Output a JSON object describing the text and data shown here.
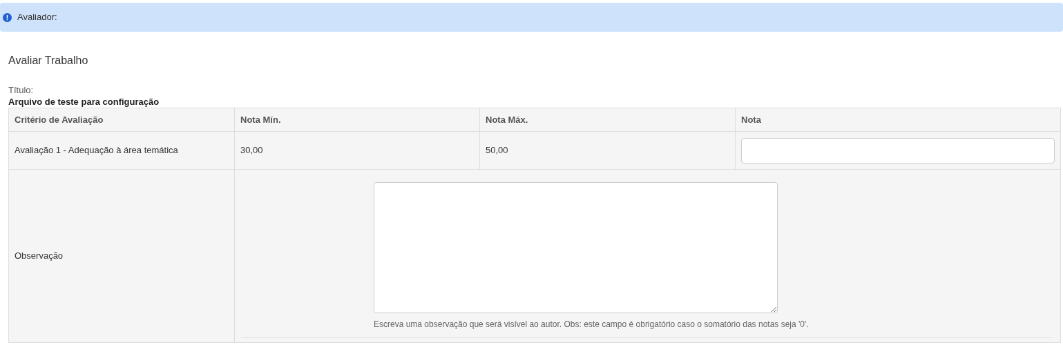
{
  "alert": {
    "text": "Avaliador:"
  },
  "heading": "Avaliar Trabalho",
  "title_label": "Título:",
  "title_value": "Arquivo de teste para configuração",
  "table": {
    "columns": [
      "Critério de Avaliação",
      "Nota Mín.",
      "Nota Máx.",
      "Nota"
    ],
    "rows": [
      {
        "criterion": "Avaliação 1 - Adequação à área temática",
        "min": "30,00",
        "max": "50,00"
      }
    ],
    "observation": {
      "label": "Observação",
      "help": "Escreva uma observação que será visível ao autor. Obs: este campo é obrigatório caso o somatório das notas seja '0'."
    }
  }
}
